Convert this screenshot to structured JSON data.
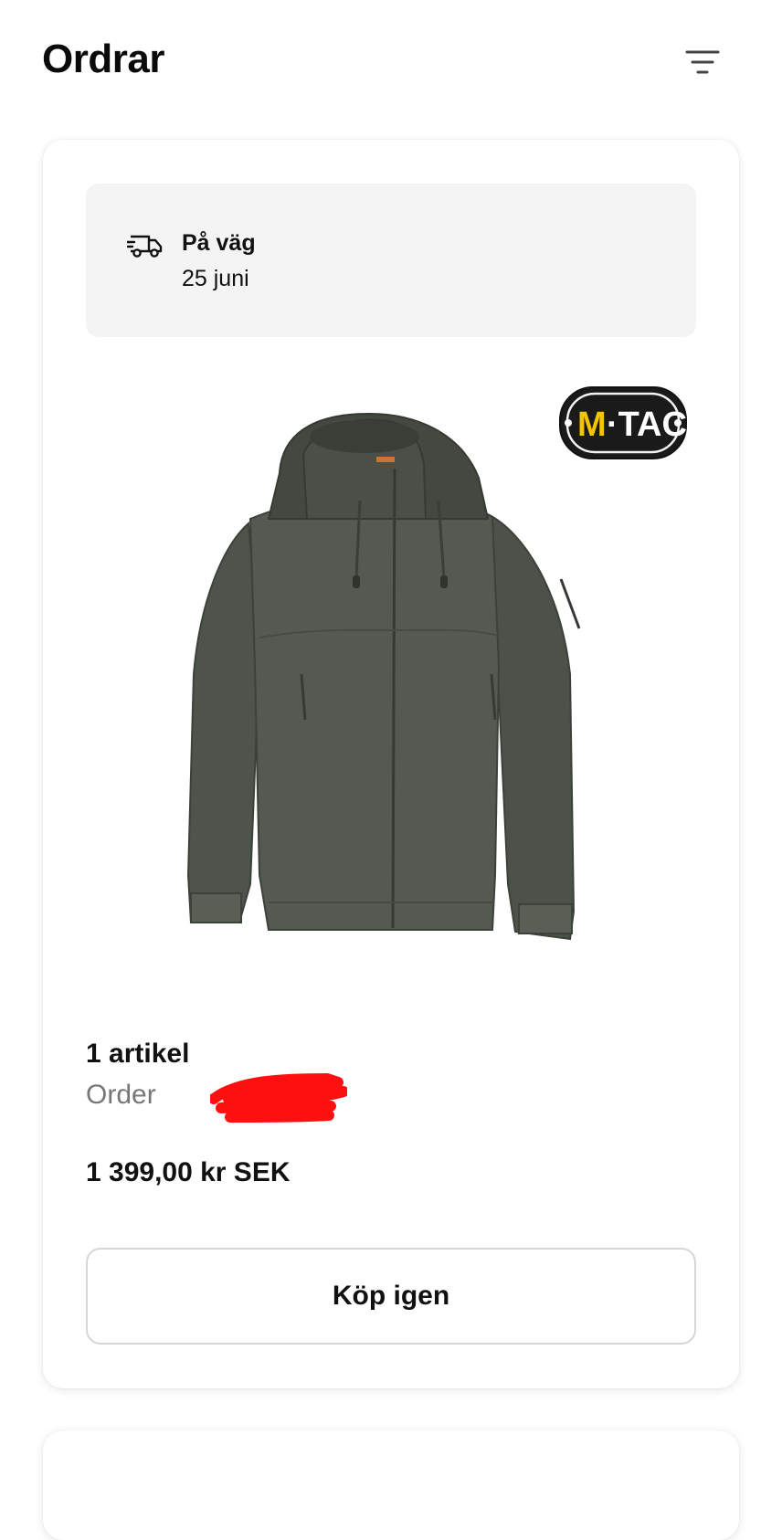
{
  "header": {
    "title": "Ordrar",
    "filter_icon": "filter-lines-icon"
  },
  "orders": [
    {
      "status": {
        "icon": "delivery-truck-icon",
        "label": "På väg",
        "date": "25 juni"
      },
      "product": {
        "image": "olive-green-hooded-jacket",
        "brand_logo_text": "M·TAC"
      },
      "items_count": "1 artikel",
      "order_label": "Order",
      "price": "1 399,00 kr SEK",
      "buy_again_label": "Köp igen"
    }
  ],
  "colors": {
    "jacket": "#4a5048",
    "logo_yellow": "#f5c400",
    "status_bg": "#f4f4f4",
    "muted_text": "#777777",
    "redaction": "#ff1010"
  }
}
